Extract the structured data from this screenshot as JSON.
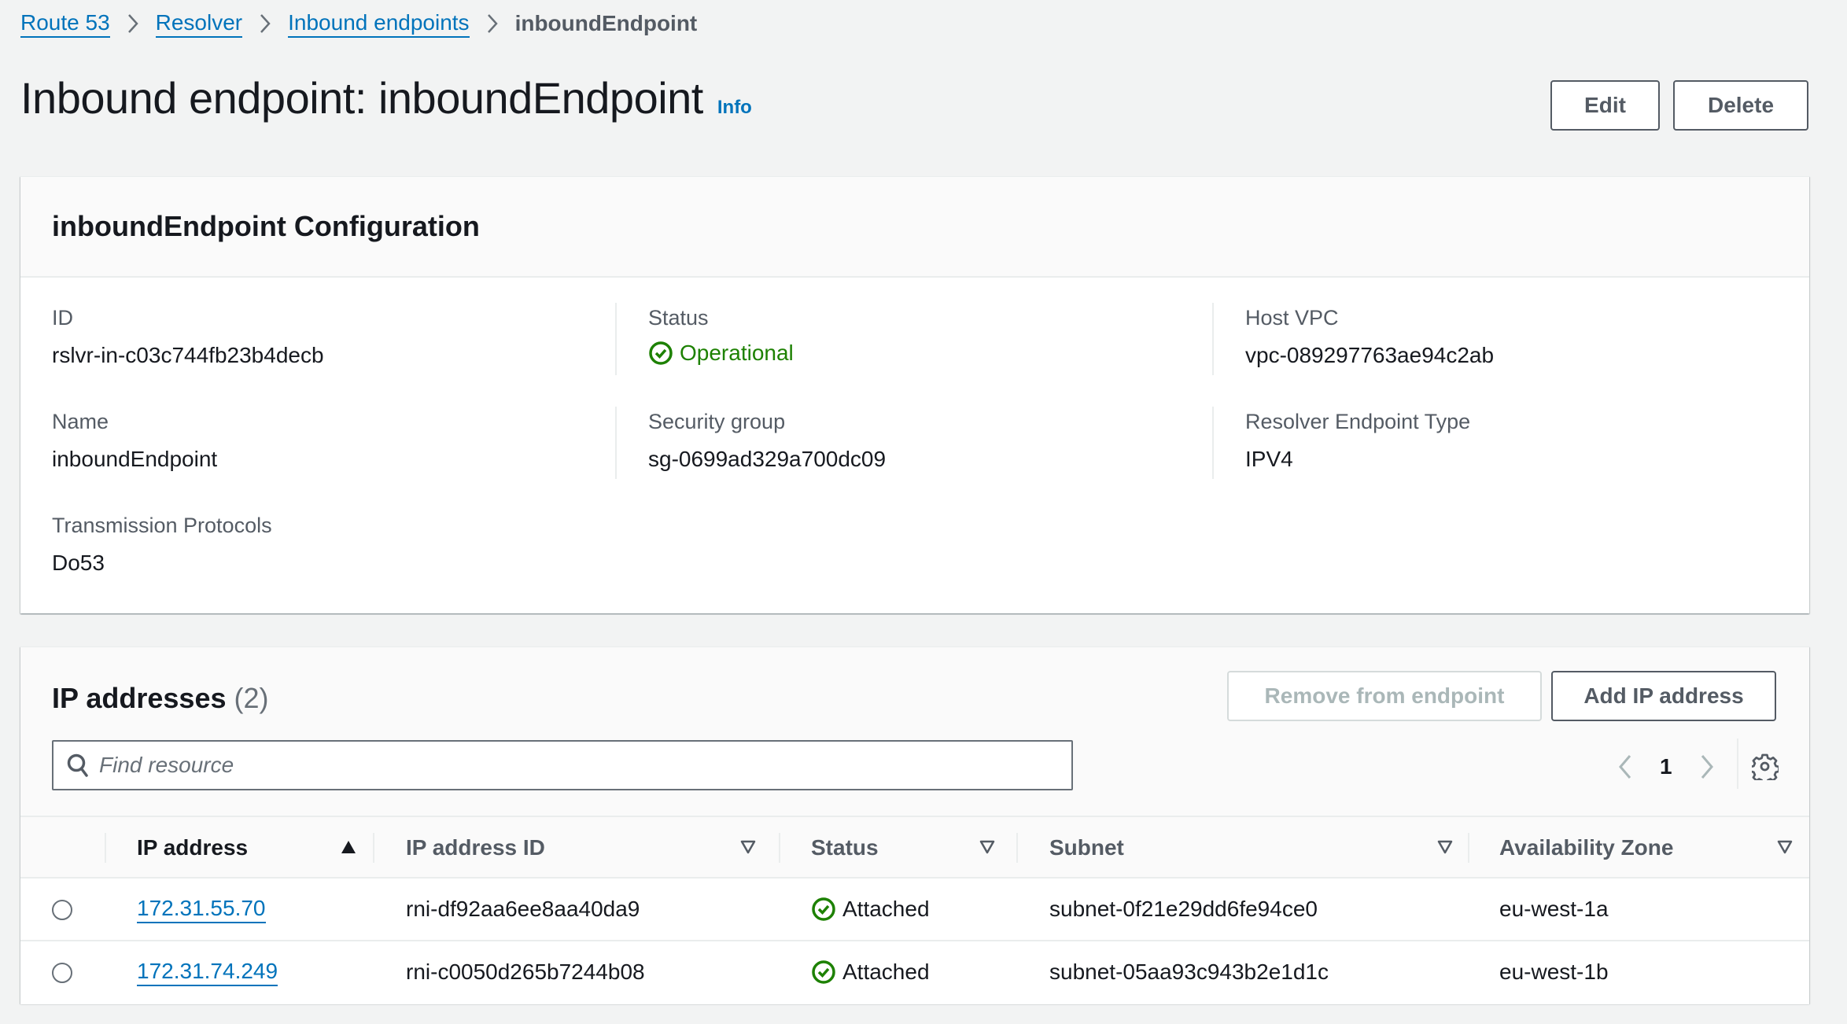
{
  "breadcrumb": {
    "items": [
      {
        "label": "Route 53"
      },
      {
        "label": "Resolver"
      },
      {
        "label": "Inbound endpoints"
      }
    ],
    "current": "inboundEndpoint"
  },
  "header": {
    "title": "Inbound endpoint: inboundEndpoint",
    "info_label": "Info",
    "edit_label": "Edit",
    "delete_label": "Delete"
  },
  "config": {
    "title": "inboundEndpoint Configuration",
    "fields": {
      "id": {
        "label": "ID",
        "value": "rslvr-in-c03c744fb23b4decb"
      },
      "status": {
        "label": "Status",
        "value": "Operational"
      },
      "host_vpc": {
        "label": "Host VPC",
        "value": "vpc-089297763ae94c2ab"
      },
      "name": {
        "label": "Name",
        "value": "inboundEndpoint"
      },
      "security_group": {
        "label": "Security group",
        "value": "sg-0699ad329a700dc09"
      },
      "endpoint_type": {
        "label": "Resolver Endpoint Type",
        "value": "IPV4"
      },
      "protocols": {
        "label": "Transmission Protocols",
        "value": "Do53"
      }
    }
  },
  "ip_addresses": {
    "title": "IP addresses",
    "count": "(2)",
    "remove_label": "Remove from endpoint",
    "add_label": "Add IP address",
    "search_placeholder": "Find resource",
    "search_value": "",
    "page": "1",
    "columns": [
      {
        "label": "IP address",
        "sort": "ascending"
      },
      {
        "label": "IP address ID",
        "sort": "none"
      },
      {
        "label": "Status",
        "sort": "none"
      },
      {
        "label": "Subnet",
        "sort": "none"
      },
      {
        "label": "Availability Zone",
        "sort": "none"
      }
    ],
    "rows": [
      {
        "ip": "172.31.55.70",
        "ip_id": "rni-df92aa6ee8aa40da9",
        "status": "Attached",
        "subnet": "subnet-0f21e29dd6fe94ce0",
        "az": "eu-west-1a",
        "selected": false
      },
      {
        "ip": "172.31.74.249",
        "ip_id": "rni-c0050d265b7244b08",
        "status": "Attached",
        "subnet": "subnet-05aa93c943b2e1d1c",
        "az": "eu-west-1b",
        "selected": false
      }
    ]
  },
  "colors": {
    "link": "#0073bb",
    "success": "#1d8102",
    "text": "#16191f",
    "muted": "#545b64",
    "background": "#f2f3f3"
  }
}
